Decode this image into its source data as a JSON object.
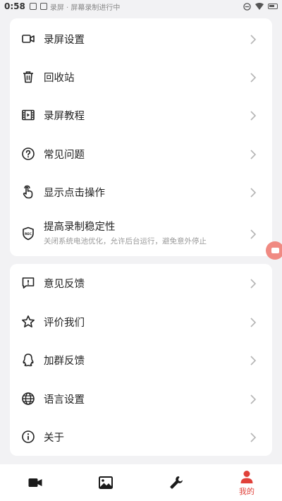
{
  "status_bar": {
    "time": "0:58",
    "notification_text": "录屏 · 屏幕录制进行中"
  },
  "colors": {
    "accent": "#e0413a",
    "icon": "#222222",
    "chevron": "#b5b5b5",
    "background": "#f2f2f4"
  },
  "section1": {
    "items": [
      {
        "label": "录屏设置",
        "icon": "video-camera-icon"
      },
      {
        "label": "回收站",
        "icon": "trash-icon"
      },
      {
        "label": "录屏教程",
        "icon": "film-icon"
      },
      {
        "label": "常见问题",
        "icon": "question-circle-icon"
      },
      {
        "label": "显示点击操作",
        "icon": "tap-hand-icon"
      },
      {
        "label": "提高录制稳定性",
        "sub": "关闭系统电池优化，允许后台运行，避免意外停止",
        "icon": "rec-shield-icon"
      }
    ]
  },
  "section2": {
    "items": [
      {
        "label": "意见反馈",
        "icon": "feedback-icon"
      },
      {
        "label": "评价我们",
        "icon": "star-icon"
      },
      {
        "label": "加群反馈",
        "icon": "qq-icon"
      },
      {
        "label": "语言设置",
        "icon": "globe-icon"
      },
      {
        "label": "关于",
        "icon": "info-icon"
      }
    ]
  },
  "bottom_nav": {
    "items": [
      {
        "icon": "video-camera-icon",
        "label": ""
      },
      {
        "icon": "image-icon",
        "label": ""
      },
      {
        "icon": "wrench-icon",
        "label": ""
      },
      {
        "icon": "person-icon",
        "label": "我的",
        "active": true
      }
    ]
  }
}
